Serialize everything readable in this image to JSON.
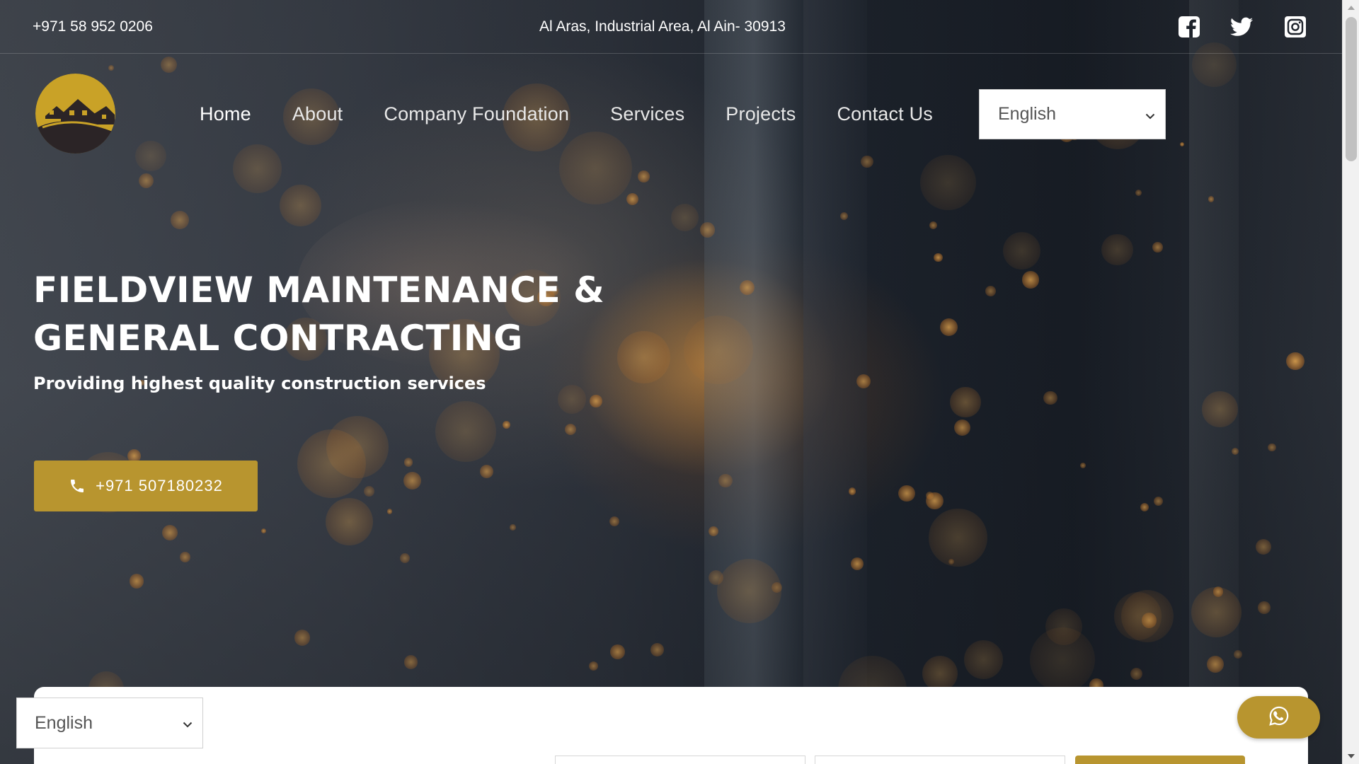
{
  "topbar": {
    "phone": "+971 58 952 0206",
    "address": "Al Aras, Industrial Area, Al Ain- 30913",
    "social": [
      "facebook-icon",
      "twitter-icon",
      "instagram-icon"
    ]
  },
  "nav": {
    "items": [
      {
        "label": "Home",
        "active": true
      },
      {
        "label": "About"
      },
      {
        "label": "Company Foundation"
      },
      {
        "label": "Services"
      },
      {
        "label": "Projects"
      },
      {
        "label": "Contact Us"
      }
    ]
  },
  "language_top": {
    "selected": "English"
  },
  "hero": {
    "title_line1": "FIELDVIEW MAINTENANCE &",
    "title_line2": "GENERAL CONTRACTING",
    "subtitle": "Providing highest quality construction services",
    "cta_label": "+971 507180232",
    "cta_icon": "phone-icon"
  },
  "language_bottom": {
    "selected": "English"
  },
  "whatsapp": {
    "icon": "whatsapp-icon"
  },
  "colors": {
    "accent": "#b8952f",
    "logo_bg": "#c9a227",
    "logo_dark": "#2b2426",
    "text_light": "#ffffff"
  }
}
